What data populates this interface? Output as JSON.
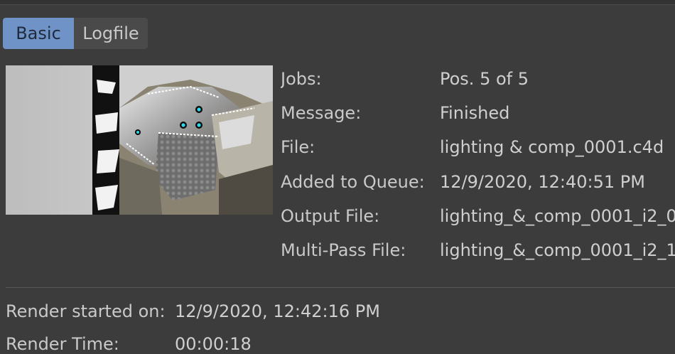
{
  "tabs": [
    {
      "label": "Basic",
      "active": true
    },
    {
      "label": "Logfile",
      "active": false
    }
  ],
  "thumbnail": {
    "icon": "render-preview-thumbnail"
  },
  "info": [
    {
      "label": "Jobs:",
      "value": "Pos. 5 of 5"
    },
    {
      "label": "Message:",
      "value": "Finished"
    },
    {
      "label": "File:",
      "value": "lighting & comp_0001.c4d"
    },
    {
      "label": "Added to Queue:",
      "value": "12/9/2020, 12:40:51 PM"
    },
    {
      "label": "Output File:",
      "value": "lighting_&_comp_0001_i2_0"
    },
    {
      "label": "Multi-Pass File:",
      "value": "lighting_&_comp_0001_i2_1"
    }
  ],
  "stats": {
    "render_started_label": "Render started on:",
    "render_started_value": "12/9/2020, 12:42:16 PM",
    "render_time_label": "Render Time:",
    "render_time_value": "00:00:18"
  },
  "colors": {
    "background": "#3c3c3c",
    "active_tab": "#6f93c6",
    "inactive_tab": "#4a4a4a",
    "text": "#c9c9c9"
  }
}
